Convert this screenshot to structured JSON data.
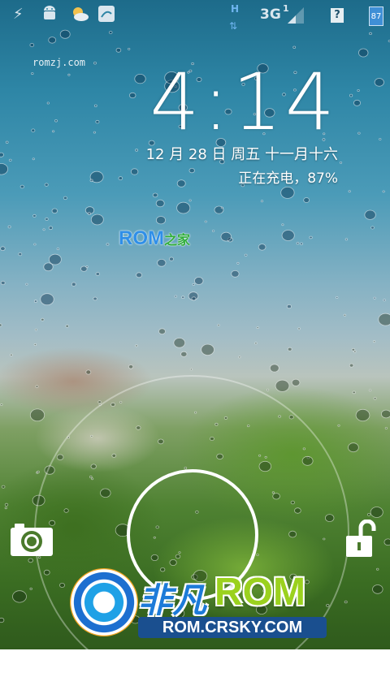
{
  "status_bar": {
    "icons": [
      "usb-icon",
      "android-debug-icon",
      "weather-icon",
      "app-notification-icon"
    ],
    "network_type": "3G",
    "signal_index": "1",
    "data_activity": "H",
    "help_icon": "?",
    "battery_level": "87"
  },
  "watermark_small": "romzj.com",
  "clock": {
    "time": "4:14",
    "date": "12 月 28 日 周五 十一月十六",
    "charging_status": "正在充电，87%"
  },
  "logo": {
    "text": "ROM",
    "suffix": "之家"
  },
  "unlock": {
    "left_target": "camera-icon",
    "right_target": "unlock-icon"
  },
  "brand_watermark": {
    "chinese": "非凡",
    "rom": "ROM",
    "url": "ROM.CRSKY.COM"
  },
  "colors": {
    "sky_top": "#1d6b8a",
    "grass": "#3a6c22",
    "ring": "#ffffff"
  }
}
